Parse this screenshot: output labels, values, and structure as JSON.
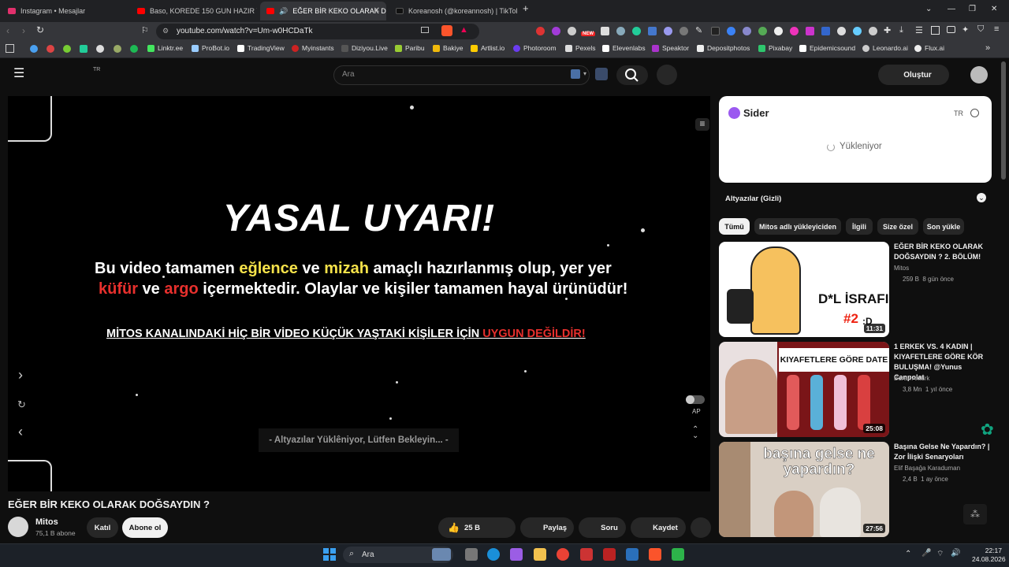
{
  "browser": {
    "tabs": [
      {
        "title": "Instagram • Mesajlar",
        "color": "#e1306c"
      },
      {
        "title": "Baso, KOREDE 150 GUN HAZIR YEME",
        "color": "#ff0000"
      },
      {
        "title": "EĞER BİR KEKO OLARAK DOĞ",
        "color": "#ff0000",
        "active": true
      },
      {
        "title": "Koreanosh (@koreannosh) | TikTok",
        "color": "#111111"
      }
    ],
    "new_tab": "+",
    "url": "youtube.com/watch?v=Um-w0HCDaTk",
    "bookmarks": [
      "Linktr.ee",
      "ProBot.io",
      "TradingView",
      "Myinstants",
      "Diziyou.Live",
      "Paribu",
      "Bakiye",
      "Artlist.io",
      "Photoroom",
      "Pexels",
      "Elevenlabs",
      "Speaktor",
      "Depositphotos",
      "Pixabay",
      "Epidemicsound",
      "Leonardo.ai",
      "Flux.ai"
    ],
    "extension_badge": "NEW"
  },
  "youtube": {
    "country": "TR",
    "search_placeholder": "Ara",
    "create_label": "Oluştur"
  },
  "video": {
    "warning_title": "YASAL UYARI!",
    "line1": {
      "a": "Bu video tamamen ",
      "b": "eğlence",
      "c": " ve ",
      "d": "mizah",
      "e": " amaçlı hazırlanmış olup, yer yer"
    },
    "line2": {
      "a": "küfür",
      "b": " ve ",
      "c": "argo",
      "d": " içermektedir. Olaylar ve kişiler tamamen hayal ürünüdür!"
    },
    "line3": {
      "a": "MİTOS KANALINDAKİ HİÇ BİR VİDEO KÜÇÜK YAŞTAKİ KİŞİLER İÇİN ",
      "b": "UYGUN DEĞİLDİR!"
    },
    "subtitle": "- Altyazılar Yüklêniyor, Lütfen Bekleyin... -",
    "autoplay_label": "AP",
    "title": "EĞER BİR KEKO OLARAK DOĞSAYDIN ?"
  },
  "channel": {
    "name": "Mitos",
    "subs": "75,1 B abone",
    "join": "Katıl",
    "subscribe": "Abone ol"
  },
  "actions": {
    "likes": "25 B",
    "share": "Paylaş",
    "ask": "Soru",
    "save": "Kaydet"
  },
  "sidebar": {
    "sider_title": "Sider",
    "sider_lang": "TR",
    "sider_loading": "Yükleniyor",
    "captions": "Altyazılar (Gizli)",
    "chips": [
      "Tümü",
      "Mitos adlı yükleyiciden",
      "İlgili",
      "Size özel",
      "Son yükle"
    ],
    "videos": [
      {
        "title": "EĞER BİR KEKO OLARAK DOĞSAYDIN ? 2. BÖLÜM!",
        "channel": "Mitos",
        "views": "259 B",
        "age": "8 gün önce",
        "duration": "11:31",
        "thumb_text": "D*L İSRAFI",
        "thumb_num": "#2",
        "thumb_smile": ":D"
      },
      {
        "title": "1 ERKEK VS. 4 KADIN | KIYAFETLERE GÖRE KÖR BULUŞMA! @Yunus Canpolat",
        "channel": "Burak Aktürk",
        "views": "3,8 Mn",
        "age": "1 yıl önce",
        "duration": "25:08",
        "thumb_text": "KIYAFETLERE GÖRE DATE"
      },
      {
        "title": "Başına Gelse Ne Yapardın? | Zor İlişki Senaryoları",
        "channel": "Elif Başağa Karaduman",
        "views": "2,4 B",
        "age": "1 ay önce",
        "duration": "27:56",
        "thumb_text": "başına gelse ne yapardın?"
      }
    ]
  },
  "taskbar": {
    "search": "Ara",
    "time": "22:17",
    "date": "24.08.2026"
  },
  "colors": {
    "bg": "#0f0f0f",
    "accent_red": "#e8302d",
    "accent_yellow": "#f5e24a"
  }
}
